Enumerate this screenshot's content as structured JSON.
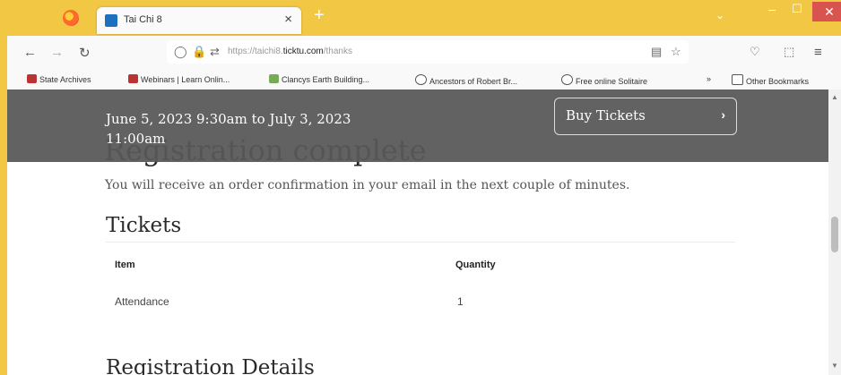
{
  "browser": {
    "tab_title": "Tai Chi 8",
    "tab_close": "×",
    "new_tab": "+",
    "tab_list": "⌄",
    "url_host_prefix": "https://taichi8.",
    "url_host_main": "ticktu.com",
    "url_path": "/thanks",
    "win_min": "–",
    "win_max": "☐",
    "win_close": "✕",
    "bookmarks": [
      "State Archives",
      "Webinars | Learn Onlin...",
      "Clancys Earth Building...",
      "Ancestors of Robert Br...",
      "Free online Solitaire"
    ],
    "bookmarks_more": "»",
    "other_bookmarks": "Other Bookmarks",
    "bookmark_colors": [
      "#b33",
      "#b33",
      "#7a5",
      "#555",
      "#555"
    ]
  },
  "header": {
    "event_dates": "June 5, 2023 9:30am to July 3, 2023\n11:00am",
    "buy_button": "Buy Tickets",
    "buy_chevron": "›"
  },
  "content": {
    "title": "Registration complete",
    "confirmation": "You will receive an order confirmation in your email in the next couple of minutes.",
    "tickets_heading": "Tickets",
    "table": {
      "columns": [
        "Item",
        "Quantity"
      ],
      "rows": [
        [
          "Attendance",
          "1"
        ]
      ]
    },
    "details_heading": "Registration Details"
  }
}
